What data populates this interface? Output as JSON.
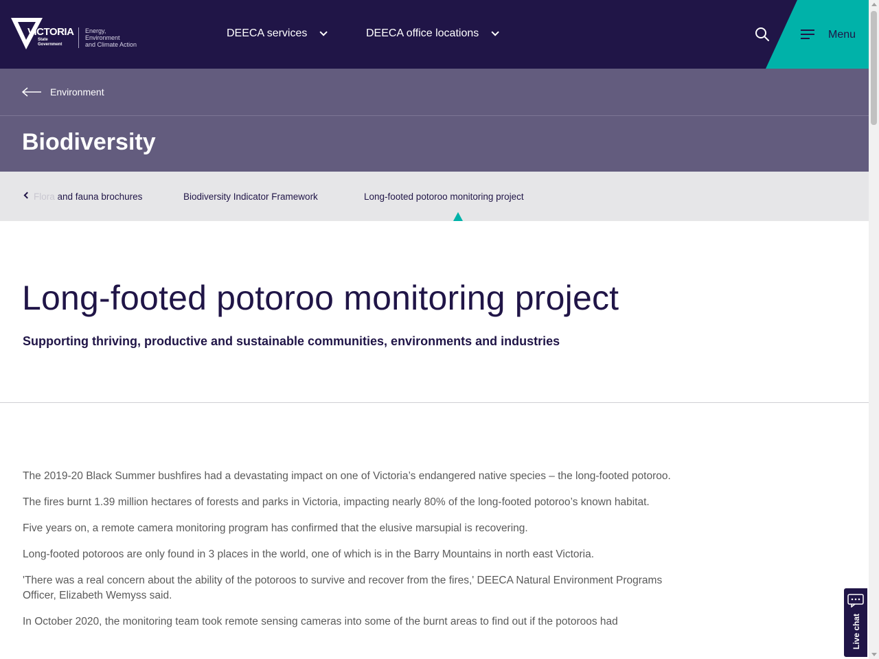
{
  "header": {
    "logo": {
      "wordmark": "VICTORIA",
      "sub": "State Government",
      "dept_line1": "Energy,",
      "dept_line2": "Environment",
      "dept_line3": "and Climate Action"
    },
    "nav": [
      {
        "label": "DEECA services"
      },
      {
        "label": "DEECA office locations"
      }
    ],
    "menu_label": "Menu"
  },
  "breadcrumb": {
    "back_label": "Environment"
  },
  "section": {
    "title": "Biodiversity"
  },
  "subnav": {
    "items": [
      {
        "label": "Flora and fauna brochures"
      },
      {
        "label": "Biodiversity Indicator Framework"
      },
      {
        "label": "Long-footed potoroo monitoring project"
      }
    ]
  },
  "page": {
    "title": "Long-footed potoroo monitoring project",
    "intro": "Supporting thriving, productive and sustainable communities, environments and industries",
    "paragraphs": [
      "The 2019-20 Black Summer bushfires had a devastating impact on one of Victoria’s endangered native species – the long-footed potoroo.",
      "The fires burnt 1.39 million hectares of forests and parks in Victoria, impacting nearly 80% of the long-footed potoroo’s known habitat.",
      "Five years on, a remote camera monitoring program has confirmed that the elusive marsupial is recovering.",
      "Long-footed potoroos are only found in 3 places in the world, one of which is in the Barry Mountains in north east Victoria.",
      "'There was a real concern about the ability of the potoroos to survive and recover from the fires,' DEECA Natural Environment Programs Officer, Elizabeth Wemyss said.",
      "In October 2020, the monitoring team took remote sensing cameras into some of the burnt areas to find out if the potoroos had"
    ]
  },
  "live_chat": {
    "label": "Live chat"
  },
  "colors": {
    "navy": "#201547",
    "teal": "#00b2a9",
    "band": "#635c7e"
  }
}
